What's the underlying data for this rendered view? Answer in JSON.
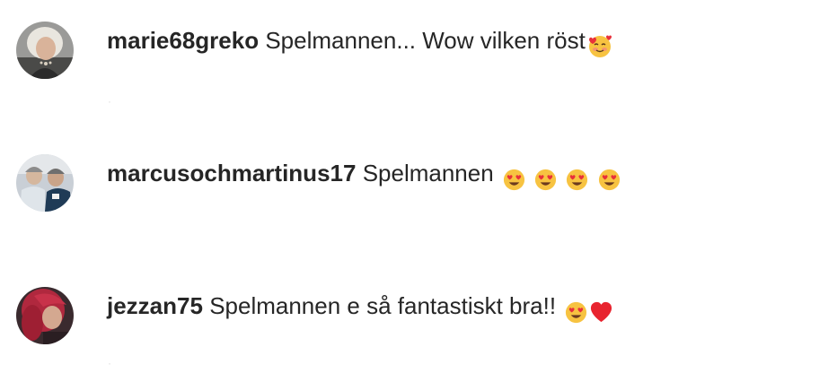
{
  "comments": [
    {
      "username": "marie68greko",
      "text": "Spelmannen... Wow vilken röst",
      "emojis": [
        "smiling-face-with-hearts"
      ]
    },
    {
      "username": "marcusochmartinus17",
      "text": "Spelmannen",
      "emojis": [
        "heart-eyes",
        "heart-eyes",
        "heart-eyes",
        "heart-eyes"
      ]
    },
    {
      "username": "jezzan75",
      "text": "Spelmannen e så fantastiskt bra!!",
      "emojis": [
        "heart-eyes",
        "red-heart"
      ]
    }
  ],
  "colors": {
    "text": "#262626",
    "background": "#ffffff"
  }
}
